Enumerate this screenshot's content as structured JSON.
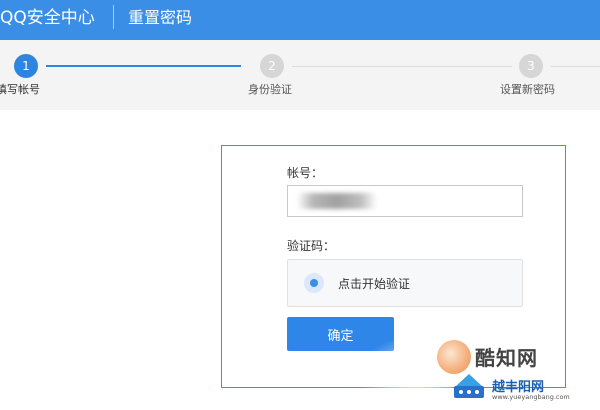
{
  "header": {
    "brand": "QQ安全中心",
    "page_title": "重置密码",
    "bg_color": "#3a8ee6"
  },
  "steps": [
    {
      "number": "1",
      "label": "填写帐号",
      "state": "active"
    },
    {
      "number": "2",
      "label": "身份验证",
      "state": "inactive"
    },
    {
      "number": "3",
      "label": "设置新密码",
      "state": "inactive"
    }
  ],
  "form": {
    "account_label": "帐号：",
    "account_value": "",
    "captcha_label": "验证码：",
    "verify_prompt": "点击开始验证",
    "confirm_label": "确定",
    "accent_color": "#2e86e8",
    "highlight_border_color": "#e05a5a"
  },
  "watermarks": {
    "kzw_text": "酷知网",
    "kzw_icon": "kzw-logo-icon",
    "yfy_name": "越丰阳网",
    "yfy_url": "www.yueyangbang.com",
    "yfy_icon": "yfy-logo-icon"
  }
}
